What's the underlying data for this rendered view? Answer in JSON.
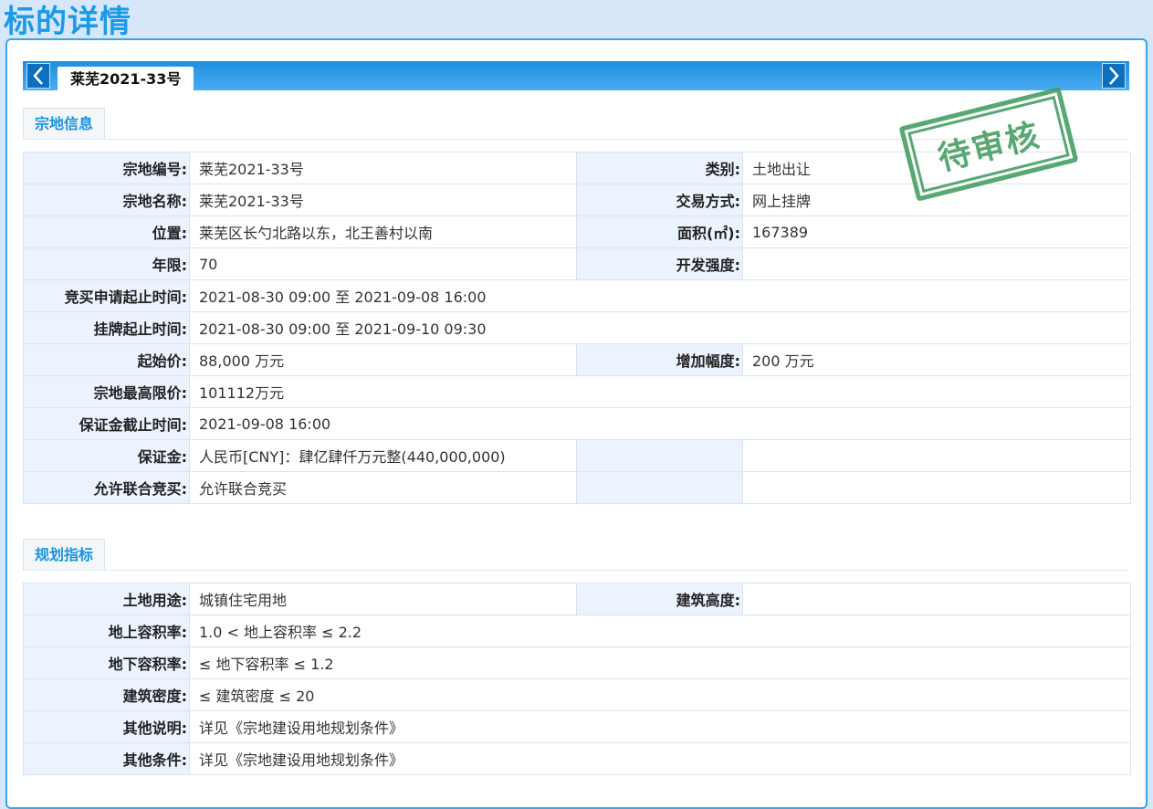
{
  "page": {
    "title": "标的详情"
  },
  "tab": {
    "label": "莱芜2021-33号"
  },
  "icons": {
    "prev": "chevron-left-icon",
    "next": "chevron-right-icon"
  },
  "stamp": {
    "text": "待审核",
    "color": "#3a9a5a"
  },
  "sections": {
    "parcel": {
      "title": "宗地信息",
      "rows": [
        {
          "l1": "宗地编号:",
          "v1": "莱芜2021-33号",
          "l2": "类别:",
          "v2": "土地出让"
        },
        {
          "l1": "宗地名称:",
          "v1": "莱芜2021-33号",
          "l2": "交易方式:",
          "v2": "网上挂牌"
        },
        {
          "l1": "位置:",
          "v1": "莱芜区长勺北路以东，北王善村以南",
          "l2": "面积(㎡):",
          "v2": "167389"
        },
        {
          "l1": "年限:",
          "v1": "70",
          "l2": "开发强度:",
          "v2": ""
        },
        {
          "l1": "竞买申请起止时间:",
          "v1": "2021-08-30 09:00 至 2021-09-08 16:00"
        },
        {
          "l1": "挂牌起止时间:",
          "v1": "2021-08-30 09:00 至 2021-09-10 09:30"
        },
        {
          "l1": "起始价:",
          "v1": "88,000 万元",
          "l2": "增加幅度:",
          "v2": "200 万元"
        },
        {
          "l1": "宗地最高限价:",
          "v1": "101112万元"
        },
        {
          "l1": "保证金截止时间:",
          "v1": "2021-09-08 16:00"
        },
        {
          "l1": "保证金:",
          "v1": "人民币[CNY]：肆亿肆仟万元整(440,000,000)",
          "l2": "",
          "v2": ""
        },
        {
          "l1": "允许联合竞买:",
          "v1": "允许联合竞买",
          "l2": "",
          "v2": ""
        }
      ]
    },
    "planning": {
      "title": "规划指标",
      "rows": [
        {
          "l1": "土地用途:",
          "v1": "城镇住宅用地",
          "l2": "建筑高度:",
          "v2": ""
        },
        {
          "l1": "地上容积率:",
          "v1": "1.0 < 地上容积率 ≤ 2.2"
        },
        {
          "l1": "地下容积率:",
          "v1": "≤ 地下容积率 ≤ 1.2"
        },
        {
          "l1": "建筑密度:",
          "v1": "≤ 建筑密度 ≤ 20"
        },
        {
          "l1": "其他说明:",
          "v1": "详见《宗地建设用地规划条件》"
        },
        {
          "l1": "其他条件:",
          "v1": "详见《宗地建设用地规划条件》"
        }
      ]
    }
  }
}
